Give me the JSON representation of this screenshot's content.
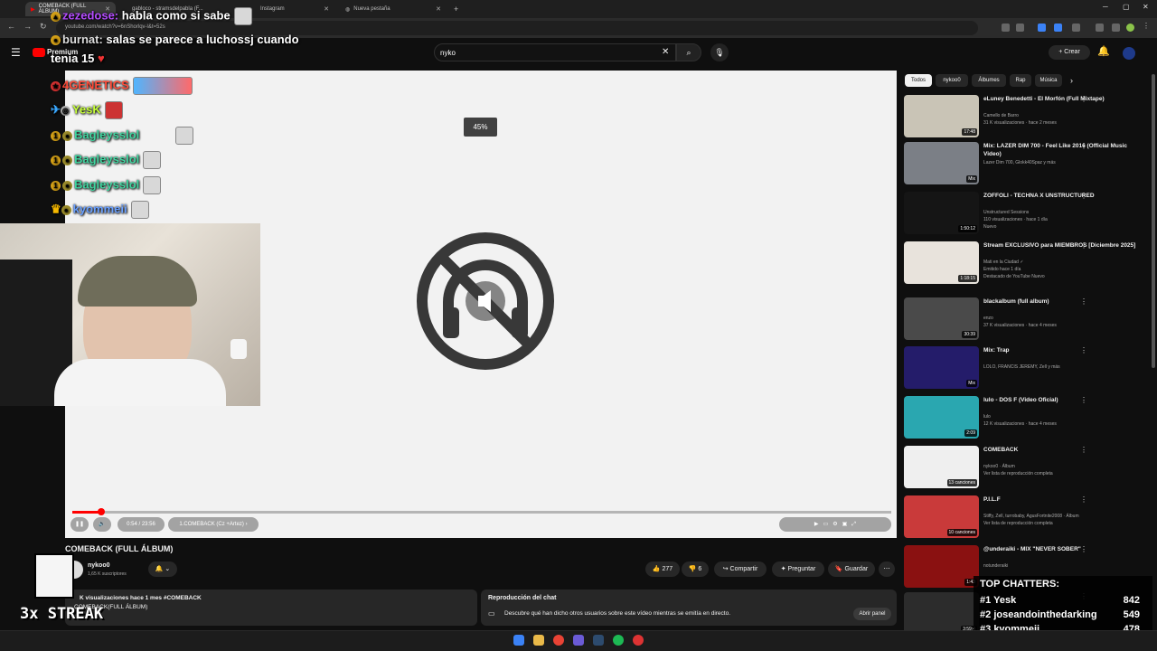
{
  "browser": {
    "tabs": [
      {
        "label": "COMEBACK (FULL ÁLBUM)",
        "active": true
      },
      {
        "label": "gabloco - stramsdelpabla (F..."
      },
      {
        "label": "Instagram"
      },
      {
        "label": "Nueva pestaña"
      }
    ],
    "new_tab": "+",
    "url": "youtube.com/watch?v=6nShorlqv-l&t=52s"
  },
  "youtube": {
    "logo_label": "Premium",
    "search_value": "nyko",
    "create_label": "Crear"
  },
  "player": {
    "volume_indicator": "45%",
    "progress_fraction": 0.035,
    "time": "0:54 / 23:56",
    "chapter": "1.COMEBACK (Cz +Artez) ›"
  },
  "video": {
    "title": "COMEBACK (FULL ÁLBUM)",
    "channel": "nykoo0",
    "subscribers": "1,65 K suscriptores",
    "likes": "277",
    "dislikes": "6",
    "share_label": "Compartir",
    "ask_label": "Preguntar",
    "save_label": "Guardar",
    "desc_views": "K visualizaciones  hace 1 mes  #COMEBACK",
    "desc_line2": "COMEBACK(FULL ÁLBUM)",
    "chat_replay_title": "Reproducción del chat",
    "chat_replay_text": "Descubre qué han dicho otros usuarios sobre este vídeo mientras se emitía en directo.",
    "chat_replay_button": "Abrir panel"
  },
  "overlay_chat": [
    {
      "user": "zezedose:",
      "msg": "habla como si sabe"
    },
    {
      "user": "burnat:",
      "msg": "salas se parece a luchossj cuando"
    },
    {
      "user": "",
      "msg": "tenia 15"
    },
    {
      "user": "4GENETICS",
      "msg": ""
    },
    {
      "user": "YesK",
      "msg": ""
    },
    {
      "user": "Bagleysslol",
      "msg": ""
    },
    {
      "user": "Bagleysslol",
      "msg": ""
    },
    {
      "user": "Bagleysslol",
      "msg": ""
    },
    {
      "user": "kyommeii",
      "msg": ""
    }
  ],
  "streak": "3x STREAK",
  "sidebar": {
    "chips": [
      "Todos",
      "nykoo0",
      "Álbumes",
      "Rap",
      "Música"
    ],
    "recs": [
      {
        "title": "eLuney Benedetti - El Morfón (Full Mixtape)",
        "meta1": "Camello de Barro",
        "meta2": "31 K visualizaciones · hace 2 meses",
        "meta3": "",
        "duration": "17:48",
        "color": "#c9c4b6"
      },
      {
        "title": "Mix: LAZER DIM 700 - Feel Like 2016 (Official Music Video)",
        "meta1": "Lazer Dim 700, Glokk40Spaz y más",
        "meta2": "",
        "meta3": "",
        "duration": "Mix",
        "color": "#7b7f86"
      },
      {
        "title": "ZOFFOLI - TECHNA X UNSTRUCTURED",
        "meta1": "Unstructured Sessions",
        "meta2": "110 visualizaciones · hace 1 día",
        "meta3": "Nuevo",
        "duration": "1:50:12",
        "color": "#151515"
      },
      {
        "title": "Stream EXCLUSIVO para MIEMBROS [Diciembre 2025]",
        "meta1": "Mati en la Ciudad ✓",
        "meta2": "Emitido hace 1 día",
        "meta3": "Destacado de YouTube  Nuevo",
        "duration": "1:18:15",
        "color": "#e8e3dc"
      },
      {
        "title": "blackalbum (full album)",
        "meta1": "enzo",
        "meta2": "37 K visualizaciones · hace 4 meses",
        "meta3": "",
        "duration": "30:39",
        "color": "#4a4a4a"
      },
      {
        "title": "Mix: Trap",
        "meta1": "LOLO, FRANCIS JEREMY, Zell y más",
        "meta2": "",
        "meta3": "",
        "duration": "Mix",
        "color": "#241c6a"
      },
      {
        "title": "lulo - DOS F (Video Oficial)",
        "meta1": "lulo",
        "meta2": "12 K visualizaciones · hace 4 meses",
        "meta3": "",
        "duration": "2:09",
        "color": "#2aa7b0"
      },
      {
        "title": "COMEBACK",
        "meta1": "nykoo0 · Álbum",
        "meta2": "Ver lista de reproducción completa",
        "meta3": "",
        "duration": "13 canciones",
        "color": "#efefef"
      },
      {
        "title": "P.I.L.F",
        "meta1": "Stiffy, Zell, turrobaby, AgusFortnite2008 · Álbum",
        "meta2": "Ver lista de reproducción completa",
        "meta3": "",
        "duration": "10 canciones",
        "color": "#c93a3a"
      },
      {
        "title": "@underaiki - MIX \"NEVER SOBER\"",
        "meta1": "notunderaiki",
        "meta2": "",
        "meta3": "",
        "duration": "1:43",
        "color": "#8a1111"
      },
      {
        "title": "",
        "meta1": "",
        "meta2": "",
        "meta3": "",
        "duration": "3:59:4",
        "color": "#2c2c2c"
      }
    ]
  },
  "top_chatters": {
    "title": "TOP CHATTERS:",
    "rows": [
      {
        "rank": "#1",
        "name": "Yesk",
        "count": "842"
      },
      {
        "rank": "#2",
        "name": "joseandointhedarking",
        "count": "549"
      },
      {
        "rank": "#3",
        "name": "kyommeii",
        "count": "478"
      }
    ]
  },
  "colors": {
    "yt_red": "#ff0000",
    "bg": "#0f0f0f",
    "chip_bg": "#272727"
  }
}
